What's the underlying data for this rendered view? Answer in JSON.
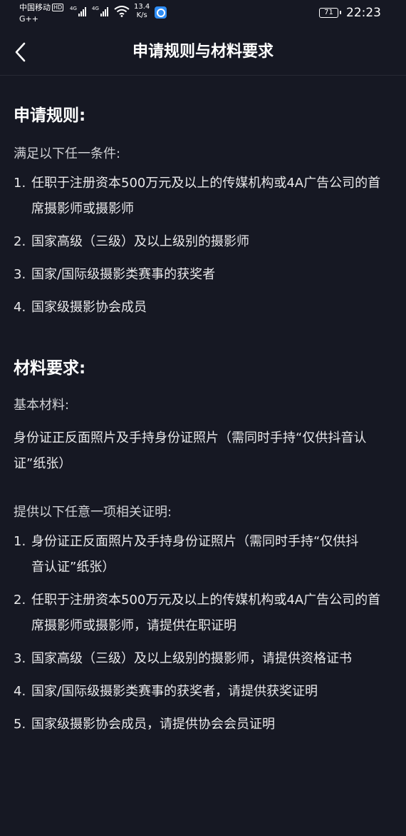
{
  "status_bar": {
    "carrier": "中国移动",
    "hd": "HD",
    "sub": "G++",
    "net1": "4G",
    "net2": "4G",
    "speed_value": "13.4",
    "speed_unit": "K/s",
    "battery": "71",
    "time": "22:23"
  },
  "nav": {
    "back_icon": "chevron-left-icon",
    "title": "申请规则与材料要求"
  },
  "rules": {
    "title": "申请规则:",
    "intro": "满足以下任一条件:",
    "items": [
      {
        "num": "1.",
        "text": "任职于注册资本500万元及以上的传媒机构或4A广告公司的首席摄影师或摄影师"
      },
      {
        "num": "2.",
        "text": "国家高级（三级）及以上级别的摄影师"
      },
      {
        "num": "3.",
        "text": "国家/国际级摄影类赛事的获奖者"
      },
      {
        "num": "4.",
        "text": "国家级摄影协会成员"
      }
    ]
  },
  "materials": {
    "title": "材料要求:",
    "basic_label": "基本材料:",
    "basic_text": "身份证正反面照片及手持身份证照片（需同时手持“仅供抖音认证”纸张）",
    "proof_label": "提供以下任意一项相关证明:",
    "items": [
      {
        "num": "1.",
        "text": "身份证正反面照片及手持身份证照片（需同时手持“仅供抖音认证”纸张）"
      },
      {
        "num": "2.",
        "text": "任职于注册资本500万元及以上的传媒机构或4A广告公司的首席摄影师或摄影师，请提供在职证明"
      },
      {
        "num": "3.",
        "text": "国家高级（三级）及以上级别的摄影师，请提供资格证书"
      },
      {
        "num": "4.",
        "text": "国家/国际级摄影类赛事的获奖者，请提供获奖证明"
      },
      {
        "num": "5.",
        "text": "国家级摄影协会成员，请提供协会会员证明"
      }
    ]
  }
}
